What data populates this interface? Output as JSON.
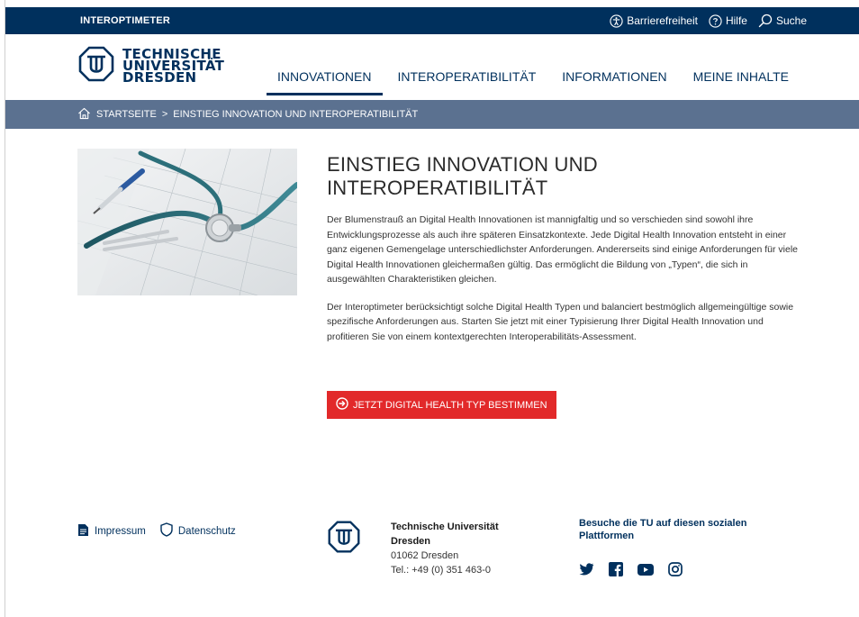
{
  "app": {
    "name": "INTEROPTIMETER"
  },
  "topbar": {
    "accessibility": "Barrierefreiheit",
    "help": "Hilfe",
    "search": "Suche"
  },
  "logo": {
    "line1": "TECHNISCHE",
    "line2": "UNIVERSITÄT",
    "line3": "DRESDEN"
  },
  "nav": {
    "items": [
      {
        "label": "INNOVATIONEN",
        "active": true
      },
      {
        "label": "INTEROPERATIBILITÄT",
        "active": false
      },
      {
        "label": "INFORMATIONEN",
        "active": false
      },
      {
        "label": "MEINE INHALTE",
        "active": false
      }
    ]
  },
  "breadcrumb": {
    "home": "STARTSEITE",
    "separator": ">",
    "current": "EINSTIEG INNOVATION UND INTEROPERATIBILITÄT"
  },
  "main": {
    "title_line1": "EINSTIEG INNOVATION UND",
    "title_line2": "INTEROPERATIBILITÄT",
    "paragraph1": "Der Blumenstrauß an Digital Health Innovationen ist mannigfaltig und so verschieden sind sowohl ihre Entwicklungsprozesse als auch ihre späteren Einsatzkontexte. Jede Digital Health Innovation entsteht in einer ganz eigenen Gemengelage unterschiedlichster Anforderungen. Andererseits sind einige Anforderungen für viele Digital Health Innovationen gleichermaßen gültig. Das ermöglicht die Bildung von „Typen“, die sich in ausgewählten Charakteristiken gleichen.",
    "paragraph2": "Der Interoptimeter berücksichtigt solche Digital Health Typen und balanciert bestmöglich allgemeingültige sowie spezifische Anforderungen aus. Starten Sie jetzt mit einer Typisierung Ihrer Digital Health Innovation und profitieren Sie von einem kontextgerechten Interoperabilitäts-Assessment.",
    "cta_label": "JETZT DIGITAL HEALTH TYP BESTIMMEN"
  },
  "footer": {
    "imprint": "Impressum",
    "privacy": "Datenschutz",
    "org_name_line1": "Technische Universität",
    "org_name_line2": "Dresden",
    "postal": "01062 Dresden",
    "phone": "Tel.: +49 (0) 351 463-0",
    "social_title": "Besuche die TU auf diesen sozialen Plattformen",
    "social_icons": [
      "twitter-icon",
      "facebook-icon",
      "youtube-icon",
      "instagram-icon"
    ]
  },
  "colors": {
    "primary": "#00305d",
    "breadcrumb_bg": "#5b7190",
    "cta": "#e2292a"
  }
}
